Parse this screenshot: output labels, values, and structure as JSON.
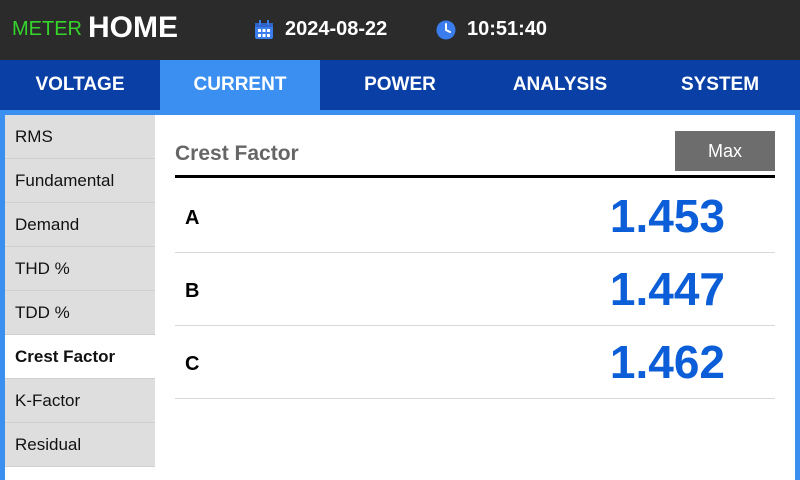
{
  "header": {
    "brand_meter": "METER",
    "brand_home": "HOME",
    "date": "2024-08-22",
    "time": "10:51:40",
    "icons": {
      "date": "calendar-icon",
      "time": "clock-icon"
    },
    "colors": {
      "meter_text": "#35d42a"
    }
  },
  "tabs": [
    {
      "label": "VOLTAGE",
      "active": false
    },
    {
      "label": "CURRENT",
      "active": true
    },
    {
      "label": "POWER",
      "active": false
    },
    {
      "label": "ANALYSIS",
      "active": false
    },
    {
      "label": "SYSTEM",
      "active": false
    }
  ],
  "sidebar": {
    "items": [
      {
        "label": "RMS",
        "active": false
      },
      {
        "label": "Fundamental",
        "active": false
      },
      {
        "label": "Demand",
        "active": false
      },
      {
        "label": "THD %",
        "active": false
      },
      {
        "label": "TDD %",
        "active": false
      },
      {
        "label": "Crest Factor",
        "active": true
      },
      {
        "label": "K-Factor",
        "active": false
      },
      {
        "label": "Residual",
        "active": false
      }
    ]
  },
  "main": {
    "title": "Crest Factor",
    "max_button": "Max",
    "rows": [
      {
        "label": "A",
        "value": "1.453"
      },
      {
        "label": "B",
        "value": "1.447"
      },
      {
        "label": "C",
        "value": "1.462"
      }
    ]
  },
  "colors": {
    "tab_bar": "#0a3fa6",
    "tab_active": "#3b8ff0",
    "value_text": "#0b5ed7"
  }
}
